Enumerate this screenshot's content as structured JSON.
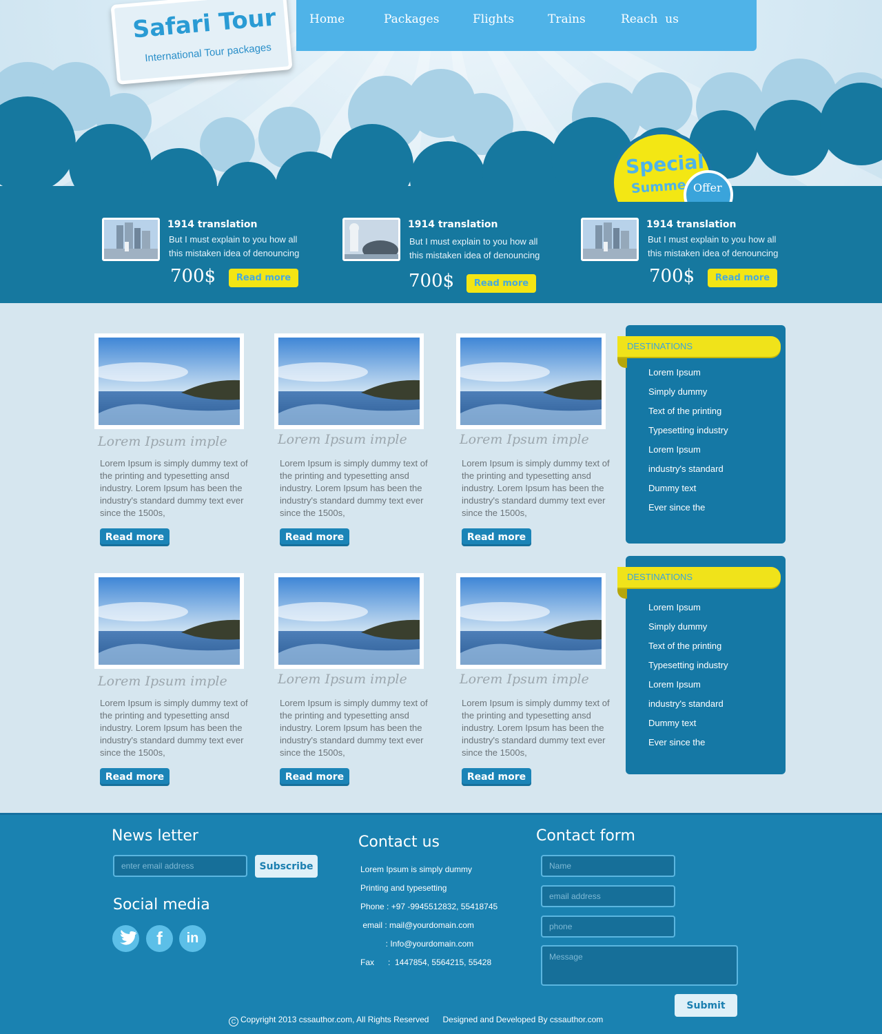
{
  "brand": {
    "title": "Safari Tour",
    "subtitle": "International Tour packages"
  },
  "nav": [
    {
      "label": "Home"
    },
    {
      "label": "Packages"
    },
    {
      "label": "Flights"
    },
    {
      "label": "Trains"
    },
    {
      "label": "Reach  us"
    }
  ],
  "special": {
    "line1": "Special",
    "line2": "Summer",
    "offer": "Offer"
  },
  "promos": [
    {
      "title": "1914 translation",
      "text": "But I must explain to you how all this mistaken idea of denouncing",
      "price": "700$",
      "button": "Read more"
    },
    {
      "title": "1914 translation",
      "text": "But I must explain to you how all this mistaken idea of denouncing",
      "price": "700$",
      "button": "Read more"
    },
    {
      "title": "1914 translation",
      "text": "But I must explain to you how all this mistaken idea of denouncing",
      "price": "700$",
      "button": "Read more"
    }
  ],
  "cards": [
    {
      "title": "Lorem Ipsum imple",
      "text": "Lorem Ipsum is simply dummy text of the printing and typesetting  ansd industry. Lorem Ipsum has been the industry's standard dummy text ever since the 1500s,",
      "button": "Read more"
    },
    {
      "title": "Lorem Ipsum imple",
      "text": "Lorem Ipsum is simply dummy text of the printing and typesetting  ansd industry. Lorem Ipsum has been the industry's standard dummy text ever since the 1500s,",
      "button": "Read more"
    },
    {
      "title": "Lorem Ipsum imple",
      "text": "Lorem Ipsum is simply dummy text of the printing and typesetting  ansd industry. Lorem Ipsum has been the industry's standard dummy text ever since the 1500s,",
      "button": "Read more"
    },
    {
      "title": "Lorem Ipsum imple",
      "text": "Lorem Ipsum is simply dummy text of the printing and typesetting  ansd industry. Lorem Ipsum has been the industry's standard dummy text ever since the 1500s,",
      "button": "Read more"
    },
    {
      "title": "Lorem Ipsum imple",
      "text": "Lorem Ipsum is simply dummy text of the printing and typesetting  ansd industry. Lorem Ipsum has been the industry's standard dummy text ever since the 1500s,",
      "button": "Read more"
    },
    {
      "title": "Lorem Ipsum imple",
      "text": "Lorem Ipsum is simply dummy text of the printing and typesetting  ansd industry. Lorem Ipsum has been the industry's standard dummy text ever since the 1500s,",
      "button": "Read more"
    }
  ],
  "destinations": [
    {
      "title": "DESTINATIONS",
      "items": [
        "Lorem Ipsum",
        "Simply dummy",
        "Text of the printing",
        "Typesetting industry",
        "Lorem Ipsum",
        "industry's standard",
        "Dummy text",
        "Ever since the"
      ]
    },
    {
      "title": "DESTINATIONS",
      "items": [
        "Lorem Ipsum",
        "Simply dummy",
        "Text of the printing",
        "Typesetting industry",
        "Lorem Ipsum",
        "industry's standard",
        "Dummy text",
        "Ever since the"
      ]
    }
  ],
  "footer": {
    "newsletter": {
      "heading": "News letter",
      "placeholder": "enter email address",
      "button": "Subscribe"
    },
    "social": {
      "heading": "Social media",
      "icons": [
        "twitter-icon",
        "facebook-icon",
        "linkedin-icon"
      ]
    },
    "contact": {
      "heading": "Contact us",
      "lines": [
        "Lorem Ipsum is simply dummy",
        "Printing and typesetting",
        "Phone : +97 -9945512832, 55418745",
        " email : mail@yourdomain.com",
        "           : Info@yourdomain.com",
        "Fax      :  1447854, 5564215, 55428"
      ]
    },
    "form": {
      "heading": "Contact form",
      "name_placeholder": "Name",
      "email_placeholder": "email address",
      "phone_placeholder": "phone",
      "message_placeholder": "Message",
      "submit": "Submit"
    },
    "copyright": "Copyright 2013 cssauthor.com, All Rights Reserved      Designed and Developed By cssauthor.com"
  },
  "colors": {
    "accent": "#4fb3e8",
    "dark": "#16789f",
    "yellow": "#f3e514"
  }
}
